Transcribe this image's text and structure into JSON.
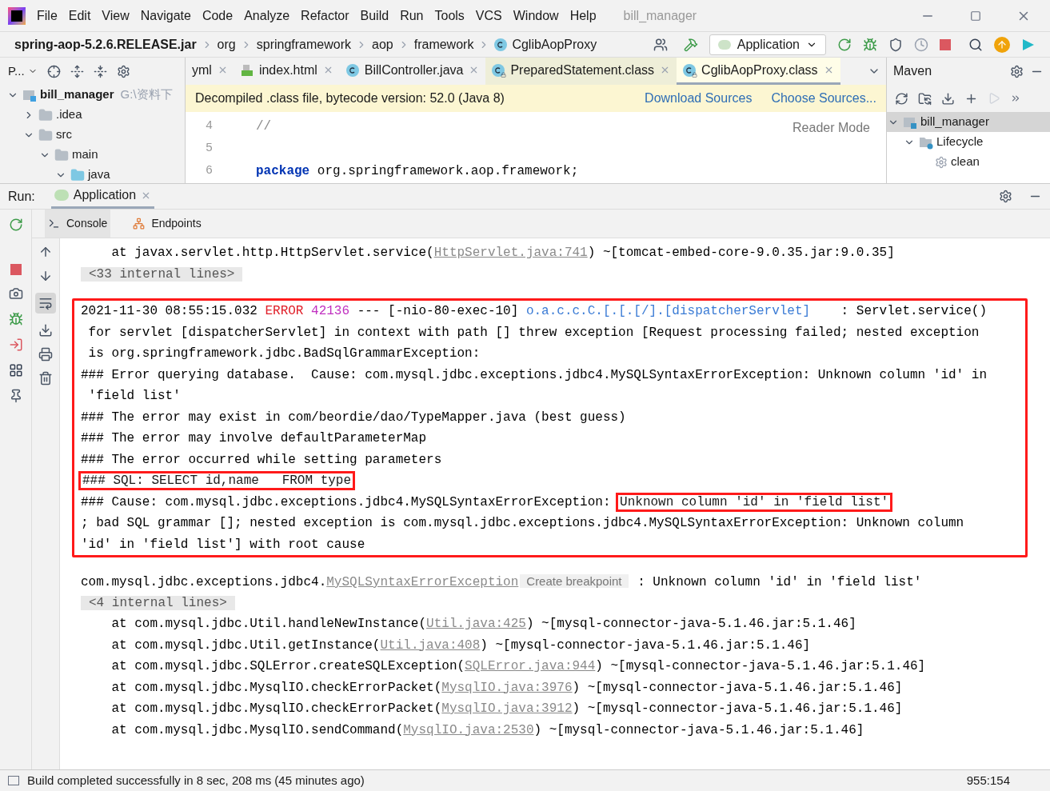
{
  "window": {
    "title": "bill_manager"
  },
  "menu": [
    "File",
    "Edit",
    "View",
    "Navigate",
    "Code",
    "Analyze",
    "Refactor",
    "Build",
    "Run",
    "Tools",
    "VCS",
    "Window",
    "Help"
  ],
  "breadcrumbs": [
    {
      "label": "spring-aop-5.2.6.RELEASE.jar",
      "kind": "root"
    },
    {
      "label": "org",
      "kind": "package"
    },
    {
      "label": "springframework",
      "kind": "package"
    },
    {
      "label": "aop",
      "kind": "package"
    },
    {
      "label": "framework",
      "kind": "package"
    },
    {
      "label": "CglibAopProxy",
      "kind": "class"
    }
  ],
  "run_config": {
    "label": "Application"
  },
  "project": {
    "title": "P...",
    "tree": [
      {
        "label": "bill_manager",
        "hint": "G:\\资料下",
        "kind": "module",
        "expanded": true,
        "children": [
          {
            "label": ".idea",
            "kind": "folder",
            "expanded": false
          },
          {
            "label": "src",
            "kind": "folder",
            "expanded": true,
            "children": [
              {
                "label": "main",
                "kind": "folder",
                "expanded": true,
                "children": [
                  {
                    "label": "java",
                    "kind": "source",
                    "expanded": true
                  }
                ]
              }
            ]
          }
        ]
      }
    ]
  },
  "editor": {
    "tabs": [
      {
        "label": "yml",
        "kind": "yaml",
        "selected": false
      },
      {
        "label": "index.html",
        "kind": "html",
        "selected": false
      },
      {
        "label": "BillController.java",
        "kind": "class",
        "selected": false
      },
      {
        "label": "PreparedStatement.class",
        "kind": "locked",
        "selected": false
      },
      {
        "label": "CglibAopProxy.class",
        "kind": "locked",
        "selected": true
      }
    ],
    "banner": {
      "text": "Decompiled .class file, bytecode version: 52.0 (Java 8)",
      "links": [
        "Download Sources",
        "Choose Sources..."
      ]
    },
    "reader_mode": "Reader Mode",
    "lines": [
      {
        "number": "4",
        "segments": [
          {
            "text": "//",
            "kind": "comment"
          }
        ]
      },
      {
        "number": "5"
      },
      {
        "number": "6",
        "segments": [
          {
            "text": "package",
            "kind": "keyword"
          },
          {
            "text": " org.springframework.aop.framework;",
            "kind": "text"
          }
        ]
      }
    ]
  },
  "maven": {
    "title": "Maven",
    "tree": [
      {
        "label": "bill_manager",
        "kind": "module",
        "expanded": true,
        "selected": true,
        "children": [
          {
            "label": "Lifecycle",
            "kind": "lifecycle",
            "expanded": true,
            "selected": false,
            "children": [
              {
                "label": "clean",
                "kind": "goal",
                "selected": false
              }
            ]
          }
        ]
      }
    ]
  },
  "run": {
    "label": "Run:",
    "tab": "Application",
    "tabs": [
      {
        "label": "Console",
        "kind": "console",
        "selected": true
      },
      {
        "label": "Endpoints",
        "kind": "endpoints",
        "selected": false
      }
    ]
  },
  "console": {
    "blocks": [
      {
        "annotated": false,
        "lines": [
          [
            {
              "text": "    at javax.servlet.http.HttpServlet.service(",
              "kind": "text"
            },
            {
              "text": "HttpServlet.java:741",
              "kind": "link"
            },
            {
              "text": ") ~[tomcat-embed-core-9.0.35.jar:9.0.35]",
              "kind": "text"
            }
          ],
          [
            {
              "text": "<33 internal lines>",
              "kind": "folded"
            }
          ]
        ]
      },
      {
        "annotated": true,
        "lines": [
          [
            {
              "text": "2021-11-30 08:55:15.032 ",
              "kind": "text"
            },
            {
              "text": "ERROR",
              "kind": "error"
            },
            {
              "text": " 42136",
              "kind": "pid"
            },
            {
              "text": " --- [-nio-80-exec-10] ",
              "kind": "text"
            },
            {
              "text": "o.a.c.c.C.[.[.[/].[dispatcherServlet]",
              "kind": "logger"
            },
            {
              "text": "    : Servlet.service()",
              "kind": "text"
            }
          ],
          [
            {
              "text": " for servlet [dispatcherServlet] in context with path [] threw exception [Request processing failed; nested exception",
              "kind": "text"
            }
          ],
          [
            {
              "text": " is org.springframework.jdbc.BadSqlGrammarException:",
              "kind": "text"
            }
          ],
          [
            {
              "text": "### Error querying database.  Cause: com.mysql.jdbc.exceptions.jdbc4.MySQLSyntaxErrorException: Unknown column 'id' in",
              "kind": "text"
            }
          ],
          [
            {
              "text": " 'field list'",
              "kind": "text"
            }
          ],
          [
            {
              "text": "### The error may exist in com/beordie/dao/TypeMapper.java (best guess)",
              "kind": "text"
            }
          ],
          [
            {
              "text": "### The error may involve defaultParameterMap",
              "kind": "text"
            }
          ],
          [
            {
              "text": "### The error occurred while setting parameters",
              "kind": "text"
            }
          ],
          [
            {
              "text": "### SQL: SELECT id,name   FROM type",
              "kind": "marked"
            }
          ],
          [
            {
              "text": "### Cause: com.mysql.jdbc.exceptions.jdbc4.MySQLSyntaxErrorException: ",
              "kind": "text"
            },
            {
              "text": "Unknown column 'id' in 'field list'",
              "kind": "marked"
            }
          ],
          [
            {
              "text": "; bad SQL grammar []; nested exception is com.mysql.jdbc.exceptions.jdbc4.MySQLSyntaxErrorException: Unknown column",
              "kind": "text"
            }
          ],
          [
            {
              "text": "'id' in 'field list'] with root cause",
              "kind": "text"
            }
          ]
        ]
      },
      {
        "annotated": false,
        "lines": [
          [
            {
              "text": "com.mysql.jdbc.exceptions.jdbc4.",
              "kind": "text"
            },
            {
              "text": "MySQLSyntaxErrorException",
              "kind": "link"
            },
            {
              "text": "Create breakpoint",
              "kind": "hint"
            },
            {
              "text": " : Unknown column 'id' in 'field list'",
              "kind": "text"
            }
          ],
          [
            {
              "text": "<4 internal lines>",
              "kind": "folded"
            }
          ],
          [
            {
              "text": "    at com.mysql.jdbc.Util.handleNewInstance(",
              "kind": "text"
            },
            {
              "text": "Util.java:425",
              "kind": "link"
            },
            {
              "text": ") ~[mysql-connector-java-5.1.46.jar:5.1.46]",
              "kind": "text"
            }
          ],
          [
            {
              "text": "    at com.mysql.jdbc.Util.getInstance(",
              "kind": "text"
            },
            {
              "text": "Util.java:408",
              "kind": "link"
            },
            {
              "text": ") ~[mysql-connector-java-5.1.46.jar:5.1.46]",
              "kind": "text"
            }
          ],
          [
            {
              "text": "    at com.mysql.jdbc.SQLError.createSQLException(",
              "kind": "text"
            },
            {
              "text": "SQLError.java:944",
              "kind": "link"
            },
            {
              "text": ") ~[mysql-connector-java-5.1.46.jar:5.1.46]",
              "kind": "text"
            }
          ],
          [
            {
              "text": "    at com.mysql.jdbc.MysqlIO.checkErrorPacket(",
              "kind": "text"
            },
            {
              "text": "MysqlIO.java:3976",
              "kind": "link"
            },
            {
              "text": ") ~[mysql-connector-java-5.1.46.jar:5.1.46]",
              "kind": "text"
            }
          ],
          [
            {
              "text": "    at com.mysql.jdbc.MysqlIO.checkErrorPacket(",
              "kind": "text"
            },
            {
              "text": "MysqlIO.java:3912",
              "kind": "link"
            },
            {
              "text": ") ~[mysql-connector-java-5.1.46.jar:5.1.46]",
              "kind": "text"
            }
          ],
          [
            {
              "text": "    at com.mysql.jdbc.MysqlIO.sendCommand(",
              "kind": "text"
            },
            {
              "text": "MysqlIO.java:2530",
              "kind": "link"
            },
            {
              "text": ") ~[mysql-connector-java-5.1.46.jar:5.1.46]",
              "kind": "text"
            }
          ]
        ]
      }
    ]
  },
  "status_bar": {
    "message": "Build completed successfully in 8 sec, 208 ms (45 minutes ago)",
    "position": "955:154"
  }
}
